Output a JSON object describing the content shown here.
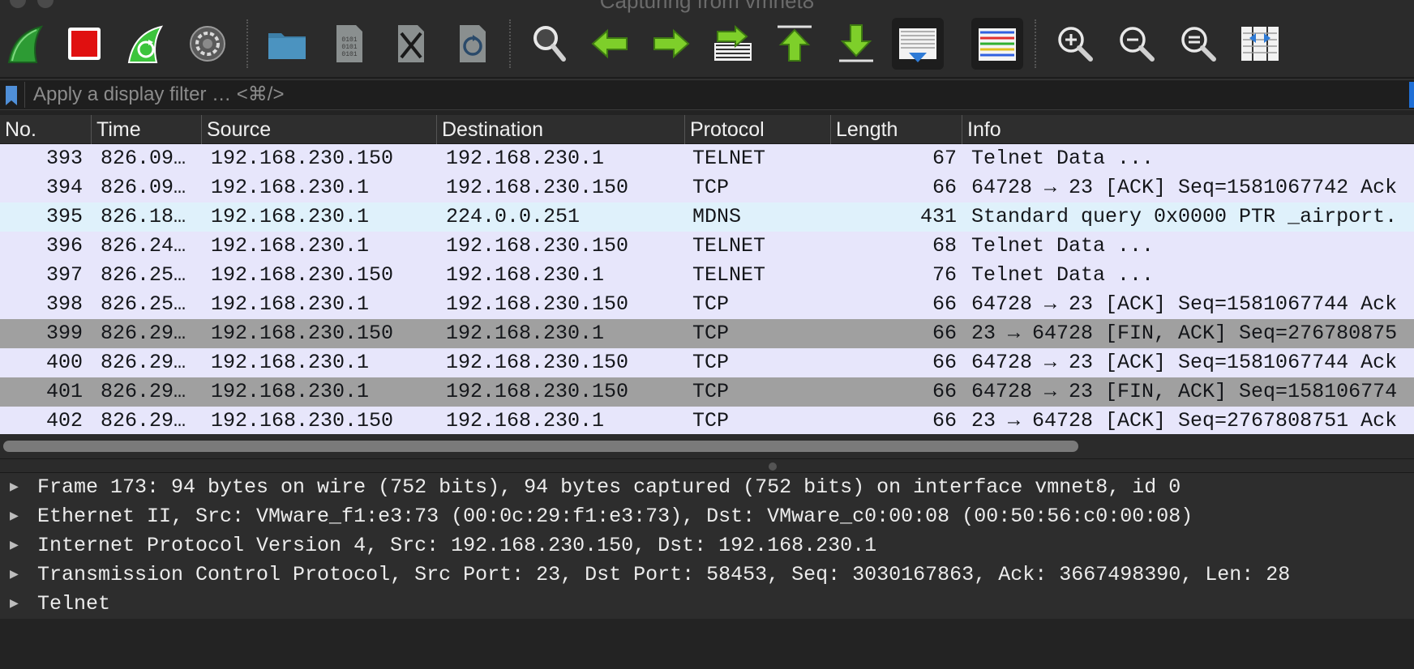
{
  "window": {
    "title": "Capturing from vmnet8"
  },
  "toolbar": {
    "buttons": [
      {
        "icon": "shark-fin-start-icon",
        "label": "Start capture"
      },
      {
        "icon": "stop-square-icon",
        "label": "Stop capture"
      },
      {
        "icon": "shark-fin-restart-icon",
        "label": "Restart capture"
      },
      {
        "icon": "gear-icon",
        "label": "Capture options"
      },
      {
        "icon": "folder-icon",
        "label": "Open"
      },
      {
        "icon": "binary-file-icon",
        "label": "Save"
      },
      {
        "icon": "close-file-icon",
        "label": "Close"
      },
      {
        "icon": "reload-file-icon",
        "label": "Reload"
      },
      {
        "icon": "search-icon",
        "label": "Find packet"
      },
      {
        "icon": "arrow-left-icon",
        "label": "Go back"
      },
      {
        "icon": "arrow-right-icon",
        "label": "Go forward"
      },
      {
        "icon": "go-to-packet-icon",
        "label": "Go to packet"
      },
      {
        "icon": "arrow-up-first-icon",
        "label": "First packet"
      },
      {
        "icon": "arrow-down-last-icon",
        "label": "Last packet"
      },
      {
        "icon": "autoscroll-icon",
        "label": "Auto scroll"
      },
      {
        "icon": "colorize-icon",
        "label": "Colorize"
      },
      {
        "icon": "zoom-in-icon",
        "label": "Zoom in"
      },
      {
        "icon": "zoom-out-icon",
        "label": "Zoom out"
      },
      {
        "icon": "zoom-normal-icon",
        "label": "Normal size"
      },
      {
        "icon": "resize-columns-icon",
        "label": "Resize columns"
      }
    ]
  },
  "filter": {
    "placeholder": "Apply a display filter … <⌘/>",
    "value": ""
  },
  "columns": {
    "no": "No.",
    "time": "Time",
    "source": "Source",
    "destination": "Destination",
    "protocol": "Protocol",
    "length": "Length",
    "info": "Info"
  },
  "packets": [
    {
      "no": "393",
      "time": "826.09…",
      "source": "192.168.230.150",
      "destination": "192.168.230.1",
      "protocol": "TELNET",
      "length": "67",
      "info": "Telnet Data ...",
      "bg": "#e7e6fb"
    },
    {
      "no": "394",
      "time": "826.09…",
      "source": "192.168.230.1",
      "destination": "192.168.230.150",
      "protocol": "TCP",
      "length": "66",
      "info": "64728 → 23 [ACK] Seq=1581067742 Ack",
      "bg": "#e7e6fb"
    },
    {
      "no": "395",
      "time": "826.18…",
      "source": "192.168.230.1",
      "destination": "224.0.0.251",
      "protocol": "MDNS",
      "length": "431",
      "info": "Standard query 0x0000 PTR _airport.",
      "bg": "#dff1fb"
    },
    {
      "no": "396",
      "time": "826.24…",
      "source": "192.168.230.1",
      "destination": "192.168.230.150",
      "protocol": "TELNET",
      "length": "68",
      "info": "Telnet Data ...",
      "bg": "#e7e6fb"
    },
    {
      "no": "397",
      "time": "826.25…",
      "source": "192.168.230.150",
      "destination": "192.168.230.1",
      "protocol": "TELNET",
      "length": "76",
      "info": "Telnet Data ...",
      "bg": "#e7e6fb"
    },
    {
      "no": "398",
      "time": "826.25…",
      "source": "192.168.230.1",
      "destination": "192.168.230.150",
      "protocol": "TCP",
      "length": "66",
      "info": "64728 → 23 [ACK] Seq=1581067744 Ack",
      "bg": "#e7e6fb"
    },
    {
      "no": "399",
      "time": "826.29…",
      "source": "192.168.230.150",
      "destination": "192.168.230.1",
      "protocol": "TCP",
      "length": "66",
      "info": "23 → 64728 [FIN, ACK] Seq=276780875",
      "bg": "#a0a0a0"
    },
    {
      "no": "400",
      "time": "826.29…",
      "source": "192.168.230.1",
      "destination": "192.168.230.150",
      "protocol": "TCP",
      "length": "66",
      "info": "64728 → 23 [ACK] Seq=1581067744 Ack",
      "bg": "#e7e6fb"
    },
    {
      "no": "401",
      "time": "826.29…",
      "source": "192.168.230.1",
      "destination": "192.168.230.150",
      "protocol": "TCP",
      "length": "66",
      "info": "64728 → 23 [FIN, ACK] Seq=158106774",
      "bg": "#a0a0a0"
    },
    {
      "no": "402",
      "time": "826.29…",
      "source": "192.168.230.150",
      "destination": "192.168.230.1",
      "protocol": "TCP",
      "length": "66",
      "info": "23 → 64728 [ACK] Seq=2767808751 Ack",
      "bg": "#e7e6fb"
    }
  ],
  "details": [
    {
      "text": "Frame 173: 94 bytes on wire (752 bits), 94 bytes captured (752 bits) on interface vmnet8, id 0"
    },
    {
      "text": "Ethernet II, Src: VMware_f1:e3:73 (00:0c:29:f1:e3:73), Dst: VMware_c0:00:08 (00:50:56:c0:00:08)"
    },
    {
      "text": "Internet Protocol Version 4, Src: 192.168.230.150, Dst: 192.168.230.1"
    },
    {
      "text": "Transmission Control Protocol, Src Port: 23, Dst Port: 58453, Seq: 3030167863, Ack: 3667498390, Len: 28"
    },
    {
      "text": "Telnet"
    }
  ],
  "colors": {
    "row_default": "#e7e6fb",
    "row_mdns": "#dff1fb",
    "row_fin": "#a0a0a0",
    "accent": "#1f6fd6"
  }
}
